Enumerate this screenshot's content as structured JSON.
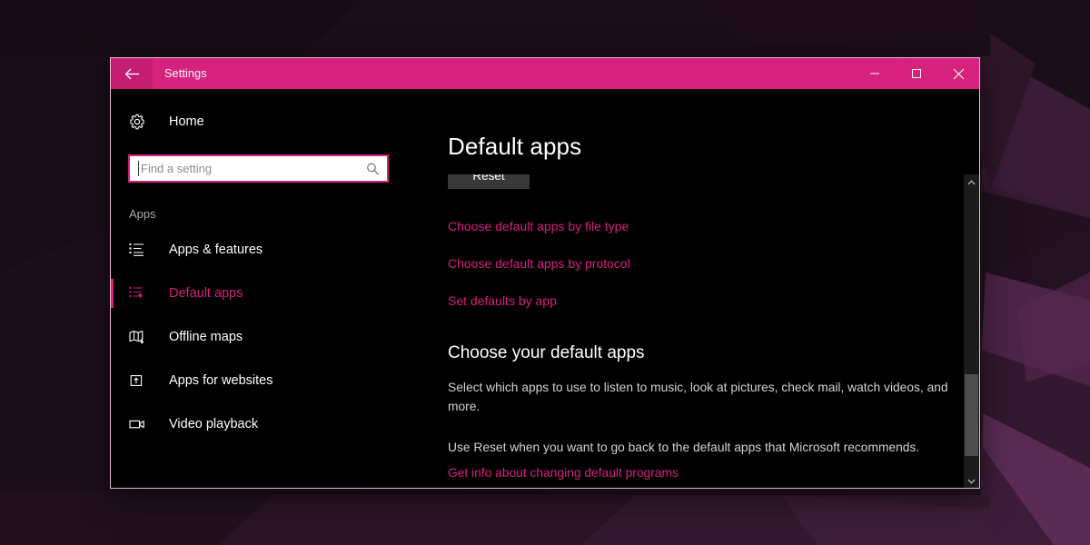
{
  "window": {
    "title": "Settings",
    "back_icon": "back-arrow-icon",
    "controls": {
      "minimize": "minimize-icon",
      "maximize": "maximize-icon",
      "close": "close-icon"
    },
    "accent_color": "#d6217d",
    "title_bar_color": "#d6217d",
    "background_color": "#000000",
    "border_color": "#e8b7d2"
  },
  "sidebar": {
    "home": {
      "label": "Home",
      "icon": "gear-icon"
    },
    "search": {
      "placeholder": "Find a setting",
      "value": "",
      "icon": "search-icon"
    },
    "section_label": "Apps",
    "items": [
      {
        "label": "Apps & features",
        "icon": "list-icon",
        "selected": false
      },
      {
        "label": "Default apps",
        "icon": "default-apps-icon",
        "selected": true
      },
      {
        "label": "Offline maps",
        "icon": "map-download-icon",
        "selected": false
      },
      {
        "label": "Apps for websites",
        "icon": "app-link-icon",
        "selected": false
      },
      {
        "label": "Video playback",
        "icon": "video-camera-icon",
        "selected": false
      }
    ]
  },
  "main": {
    "page_title": "Default apps",
    "reset_button": "Reset",
    "links": [
      "Choose default apps by file type",
      "Choose default apps by protocol",
      "Set defaults by app"
    ],
    "choose_heading": "Choose your default apps",
    "choose_description": "Select which apps to use to listen to music, look at pictures, check mail, watch videos, and more.",
    "reset_note": "Use Reset when you want to go back to the default apps that Microsoft recommends.",
    "get_info_link": "Get info about changing default programs"
  },
  "scrollbar": {
    "up_arrow": "chevron-up-icon",
    "down_arrow": "chevron-down-icon",
    "thumb_color": "#4d4d4d",
    "track_color": "#1b1b1b"
  }
}
